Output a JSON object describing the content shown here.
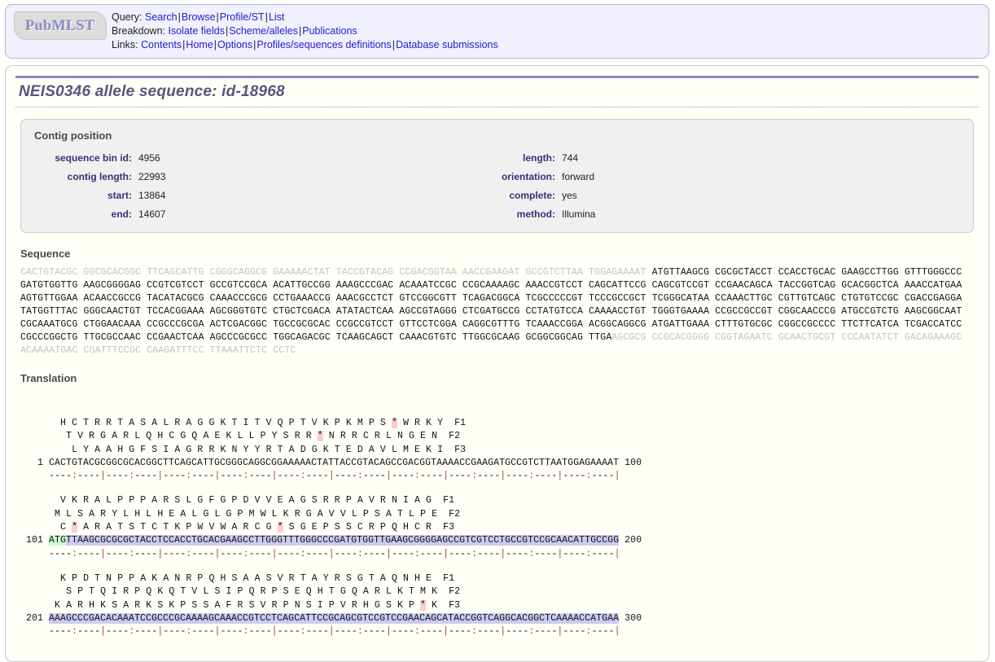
{
  "header": {
    "logo_text": "PubMLST",
    "nav": [
      {
        "label": "Query:",
        "links": [
          "Search",
          "Browse",
          "Profile/ST",
          "List"
        ]
      },
      {
        "label": "Breakdown:",
        "links": [
          "Isolate fields",
          "Scheme/alleles",
          "Publications"
        ]
      },
      {
        "label": "Links:",
        "links": [
          "Contents",
          "Home",
          "Options",
          "Profiles/sequences definitions",
          "Database submissions"
        ]
      }
    ]
  },
  "page_title": "NEIS0346 allele sequence: id-18968",
  "contig_position": {
    "heading": "Contig position",
    "left_fields": [
      {
        "key": "sequence bin id:",
        "value": "4956"
      },
      {
        "key": "contig length:",
        "value": "22993"
      },
      {
        "key": "start:",
        "value": "13864"
      },
      {
        "key": "end:",
        "value": "14607"
      }
    ],
    "right_fields": [
      {
        "key": "length:",
        "value": "744"
      },
      {
        "key": "orientation:",
        "value": "forward"
      },
      {
        "key": "complete:",
        "value": "yes"
      },
      {
        "key": "method:",
        "value": "Illumina"
      }
    ]
  },
  "sequence": {
    "heading": "Sequence",
    "lines": [
      [
        {
          "style": "flank",
          "text": "CACTGTACGC GGCGCACGGC TTCAGCATTG CGGGCAGGCG GAAAAACTAT TACCGTACAG CCGACGGTAA AACCGAAGAT GCCGTCTTAA TGGAGAAAAT "
        },
        {
          "style": "core",
          "text": "ATGTTAAGCG CGCGCTACCT CCACCTGCAC GAAGCCTTGG GTTTGGGCCC"
        }
      ],
      [
        {
          "style": "core",
          "text": "GATGTGGTTG AAGCGGGGAG CCGTCGTCCT GCCGTCCGCA ACATTGCCGG AAAGCCCGAC ACAAATCCGC CCGCAAAAGC AAACCGTCCT CAGCATTCCG CAGCGTCCGT CCGAACAGCA TACCGGTCAG GCACGGCTCA AAACCATGAA"
        }
      ],
      [
        {
          "style": "core",
          "text": "AGTGTTGGAA ACAACCGCCG TACATACGCG CAAACCCGCG CCTGAAACCG AAACGCCTCT GTCCGGCGTT TCAGACGGCA TCGCCCCCGT TCCCGCCGCT TCGGGCATAA CCAAACTTGC CGTTGTCAGC CTGTGTCCGC CGACCGAGGA"
        }
      ],
      [
        {
          "style": "core",
          "text": "TATGGTTTAC GGGCAACTGT TCCACGGAAA AGCGGGTGTC CTGCTCGACA ATATACTCAA AGCCGTAGGG CTCGATGCCG CCTATGTCCA CAAAACCTGT TGGGTGAAAA CCGCCGCCGT CGGCAACCCG ATGCCGTCTG AAGCGGCAAT"
        }
      ],
      [
        {
          "style": "core",
          "text": "CGCAAATGCG CTGGAACAAA CCGCCCGCGA ACTCGACGGC TGCCGCGCAC CCGCCGTCCT GTTCCTCGGA CAGGCGTTTG TCAAACCGGA ACGGCAGGCG ATGATTGAAA CTTTGTGCGC CGGCCGCCCC TTCTTCATCA TCGACCATCC"
        }
      ],
      [
        {
          "style": "core",
          "text": "CGCCCGGCTG TTGCGCCAAC CCGAACTCAA AGCCCGCGCC TGGCAGACGC TCAAGCAGCT CAAACGTGTC TTGGCGCAAG GCGGCGGCAG TTGA"
        },
        {
          "style": "flank",
          "text": "AGCGCG CCGCACGGGG CGGTAGAATC GCAACTGCGT CCCAATATCT GACAGAAAGC"
        }
      ],
      [
        {
          "style": "flank",
          "text": "ACAAAATGAC CGATTTCCGC CAAGATTTCC TTAAATTCTC CCTC"
        }
      ]
    ]
  },
  "translation": {
    "heading": "Translation",
    "groups": [
      {
        "frames": [
          {
            "label": "F1",
            "residues": "  H C T R R T A S A L R A G G K T I T V Q P T V K P K M P S * W R K Y "
          },
          {
            "label": "F2",
            "residues": "   T V R G A R L Q H C G Q A E K L L P Y S R R * N R R C R L N G E N "
          },
          {
            "label": "F3",
            "residues": "    L Y A A H G F S I A G R R K N Y Y R T A D G K T E D A V L M E K I "
          }
        ],
        "start": "1",
        "end": "100",
        "nt": "CACTGTACGCGGCGCACGGCTTCAGCATTGCGGGCAGGCGGAAAAACTATTACCGTACAGCCGACGGTAAAACCGAAGATGCCGTCTTAATGGAGAAAAT",
        "highlight": "none",
        "ruler": "----:----|----:----|----:----|----:----|----:----|----:----|----:----|----:----|----:----|----:----|"
      },
      {
        "frames": [
          {
            "label": "F1",
            "residues": "  V K R A L P P P A R S L G F G P D V V E A G S R R P A V R N I A G "
          },
          {
            "label": "F2",
            "residues": " M L S A R Y L H L H E A L G L G P M W L K R G A V V L P S A T L P E "
          },
          {
            "label": "F3",
            "residues": "  C * A R A T S T C T K P W V W A R C G * S G E P S S C R P Q H C R "
          }
        ],
        "start": "101",
        "end": "200",
        "nt": "ATGTTAAGCGCGCGCTACCTCCACCTGCACGAAGCCTTGGGTTTGGGCCCGATGTGGTTGAAGCGGGGAGCCGTCGTCCTGCCGTCCGCAACATTGCCGG",
        "highlight": "cds_with_start",
        "ruler": "----:----|----:----|----:----|----:----|----:----|----:----|----:----|----:----|----:----|----:----|"
      },
      {
        "frames": [
          {
            "label": "F1",
            "residues": "  K P D T N P P A K A N R P Q H S A A S V R T A Y R S G T A Q N H E "
          },
          {
            "label": "F2",
            "residues": "   S P T Q I R P Q K Q T V L S I P Q R P S E Q H T G Q A R L K T M K "
          },
          {
            "label": "F3",
            "residues": " K A R H K S A R K S K P S S A F R S V R P N S I P V R H G S K P * K "
          }
        ],
        "start": "201",
        "end": "300",
        "nt": "AAAGCCCGACACAAATCCGCCCGCAAAAGCAAACCGTCCTCAGCATTCCGCAGCGTCCGTCCGAACAGCATACCGGTCAGGCACGGCTCAAAACCATGAA",
        "highlight": "cds",
        "ruler": "----:----|----:----|----:----|----:----|----:----|----:----|----:----|----:----|----:----|----:----|"
      }
    ]
  },
  "colors": {
    "stop_codon": "#ffcccc",
    "start_codon": "#ccffcc",
    "cds": "#ccccf2",
    "flank_text": "#c2c2c2",
    "link": "#2020cc",
    "title": "#55557f"
  }
}
